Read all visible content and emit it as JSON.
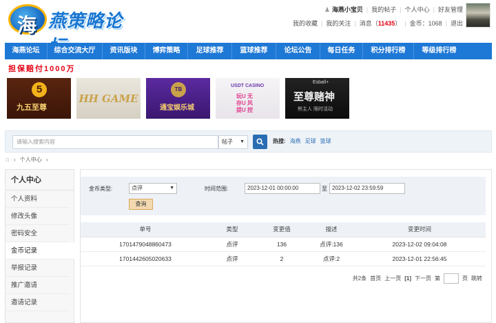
{
  "site": {
    "logo_char": "海",
    "title": "燕策略论坛"
  },
  "user_links_1": {
    "username": "海燕小宝贝",
    "my_posts": "我的帖子",
    "profile": "个人中心",
    "friends": "好友管理"
  },
  "user_links_2": {
    "favorites": "我的收藏",
    "follows": "我的关注",
    "messages_prefix": "消息（",
    "messages_count": "11435",
    "messages_suffix": "）",
    "coins_label": "金币：",
    "coins_value": "1068",
    "logout": "退出"
  },
  "nav": [
    "海燕论坛",
    "综合交流大厅",
    "资讯版块",
    "博弈策略",
    "足球推荐",
    "篮球推荐",
    "论坛公告",
    "每日任务",
    "积分排行榜",
    "等级排行榜"
  ],
  "guarantee": "担保赔付1000万",
  "ads": {
    "ad1": {
      "icon_text": "5",
      "text": "九五至尊"
    },
    "ad2": {
      "text": "HH GAME"
    },
    "ad3": {
      "icon_text": "TB",
      "text": "通宝娱乐城"
    },
    "ad4": {
      "text": "USDT CASINO",
      "side": "玩U 无\n存U 风\n提U 控"
    },
    "ad5": {
      "brand": "Esball+",
      "text": "至尊赌神",
      "sub": "熊主人 限时活动"
    }
  },
  "search": {
    "placeholder": "请输入搜索内容",
    "scope": "帖子",
    "hot_label": "热搜:",
    "hot_terms": [
      "海燕",
      "足球",
      "篮球"
    ]
  },
  "breadcrumb": {
    "current": "个人中心"
  },
  "sidebar": {
    "title": "个人中心",
    "items": [
      "个人资料",
      "修改头像",
      "密码安全",
      "金币记录",
      "举报记录",
      "推广邀请",
      "邀请记录"
    ],
    "active_index": 3
  },
  "filter": {
    "coin_type_label": "金币类型:",
    "coin_type_value": "点评",
    "time_range_label": "时间范围:",
    "date_from": "2023-12-01 00:00:00",
    "to_char": "至",
    "date_to": "2023-12-02 23:59:59",
    "query_button": "查询"
  },
  "table": {
    "headers": [
      "单号",
      "类型",
      "变更值",
      "描述",
      "变更时间"
    ],
    "rows": [
      [
        "1701479048860473",
        "点评",
        "136",
        "点评:136",
        "2023-12-02 09:04:08"
      ],
      [
        "1701442605020633",
        "点评",
        "2",
        "点评:2",
        "2023-12-01 22:56:45"
      ]
    ]
  },
  "pager": {
    "total": "共2条",
    "first": "首页",
    "prev": "上一页",
    "current": "[1]",
    "next": "下一页",
    "goto_prefix": "第",
    "goto_suffix": "页",
    "jump": "跳转"
  },
  "colors": {
    "nav_bg": "#1e78d6",
    "accent_red": "#e60012",
    "link_blue": "#2a6db3"
  }
}
